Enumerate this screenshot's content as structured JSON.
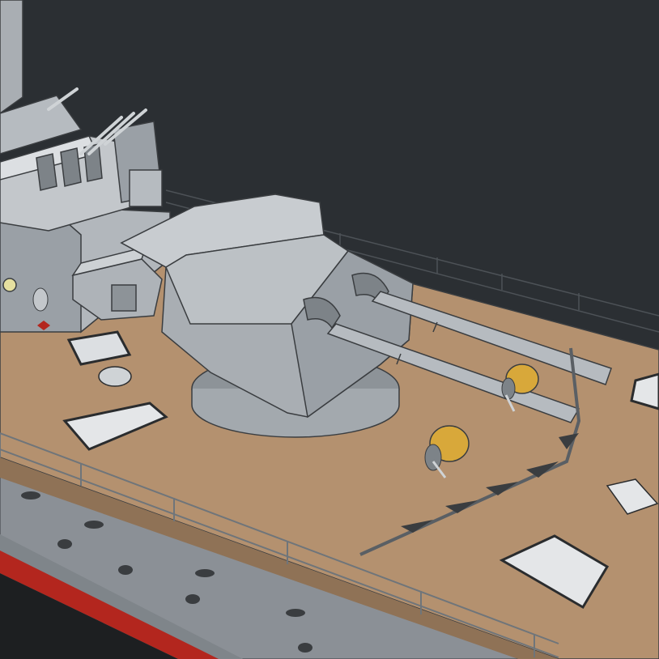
{
  "scene": {
    "subject": "",
    "colors": {
      "background": "#2b2f33",
      "deck": "#b4916f",
      "deck_shadow": "#8f7256",
      "hull_gray": "#9aa0a6",
      "steel_light": "#c3c7cb",
      "steel_mid": "#a9aeb3",
      "steel_dark": "#7d8388",
      "outline": "#3a3d40",
      "hull_red": "#b3261e",
      "cable_yellow": "#d8a83a"
    },
    "icons": [
      "turret-icon",
      "reel-icon",
      "hatch-icon",
      "railing-icon"
    ]
  }
}
